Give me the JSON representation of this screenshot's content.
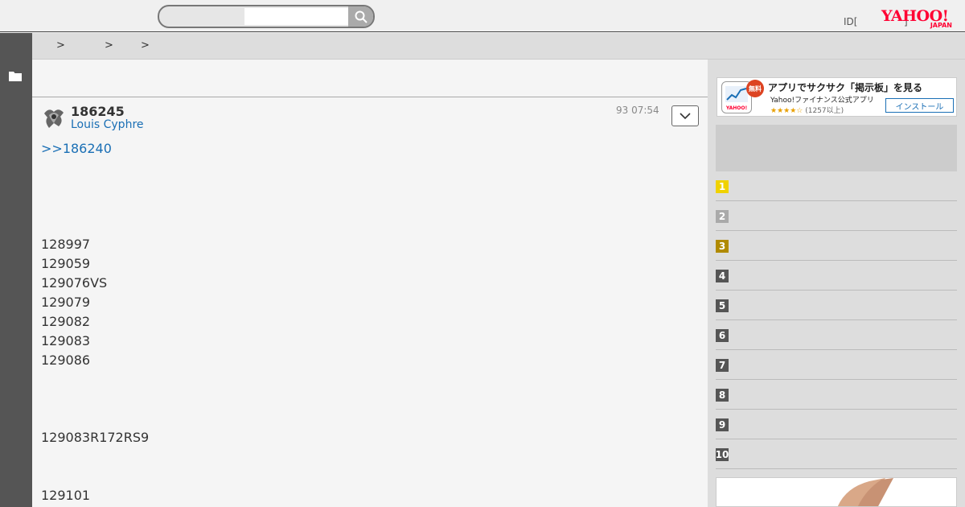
{
  "header": {
    "search_placeholder": "",
    "login_text": "ID[",
    "login_bracket": "]",
    "logo_text": "YAHOO!",
    "logo_sub": "JAPAN"
  },
  "breadcrumb": {
    "separators": [
      ">",
      ">",
      ">"
    ]
  },
  "post": {
    "number": "186245",
    "author": "Louis Cyphre",
    "time": "93 07:54",
    "reply_link": ">>186240",
    "lines": [
      "128997",
      "129059",
      "129076VS",
      "129079",
      "129082",
      "129083",
      "129086",
      "129083R172RS9",
      "129101"
    ]
  },
  "ad": {
    "free_badge": "無料",
    "title": "アプリでサクサク「掲示板」を見る",
    "subtitle": "Yahoo!ファイナンス公式アプリ",
    "stars": "★★★★☆",
    "count": "(1257以上)",
    "install": "インストール"
  },
  "ranking": [
    {
      "rank": "1",
      "color": "#f0d200"
    },
    {
      "rank": "2",
      "color": "#aaaaaa"
    },
    {
      "rank": "3",
      "color": "#b08a00"
    },
    {
      "rank": "4",
      "color": "#555555"
    },
    {
      "rank": "5",
      "color": "#555555"
    },
    {
      "rank": "6",
      "color": "#555555"
    },
    {
      "rank": "7",
      "color": "#555555"
    },
    {
      "rank": "8",
      "color": "#555555"
    },
    {
      "rank": "9",
      "color": "#555555"
    },
    {
      "rank": "10",
      "color": "#555555"
    }
  ],
  "colors": {
    "link": "#1a6fb5",
    "brand": "#ff0033"
  }
}
